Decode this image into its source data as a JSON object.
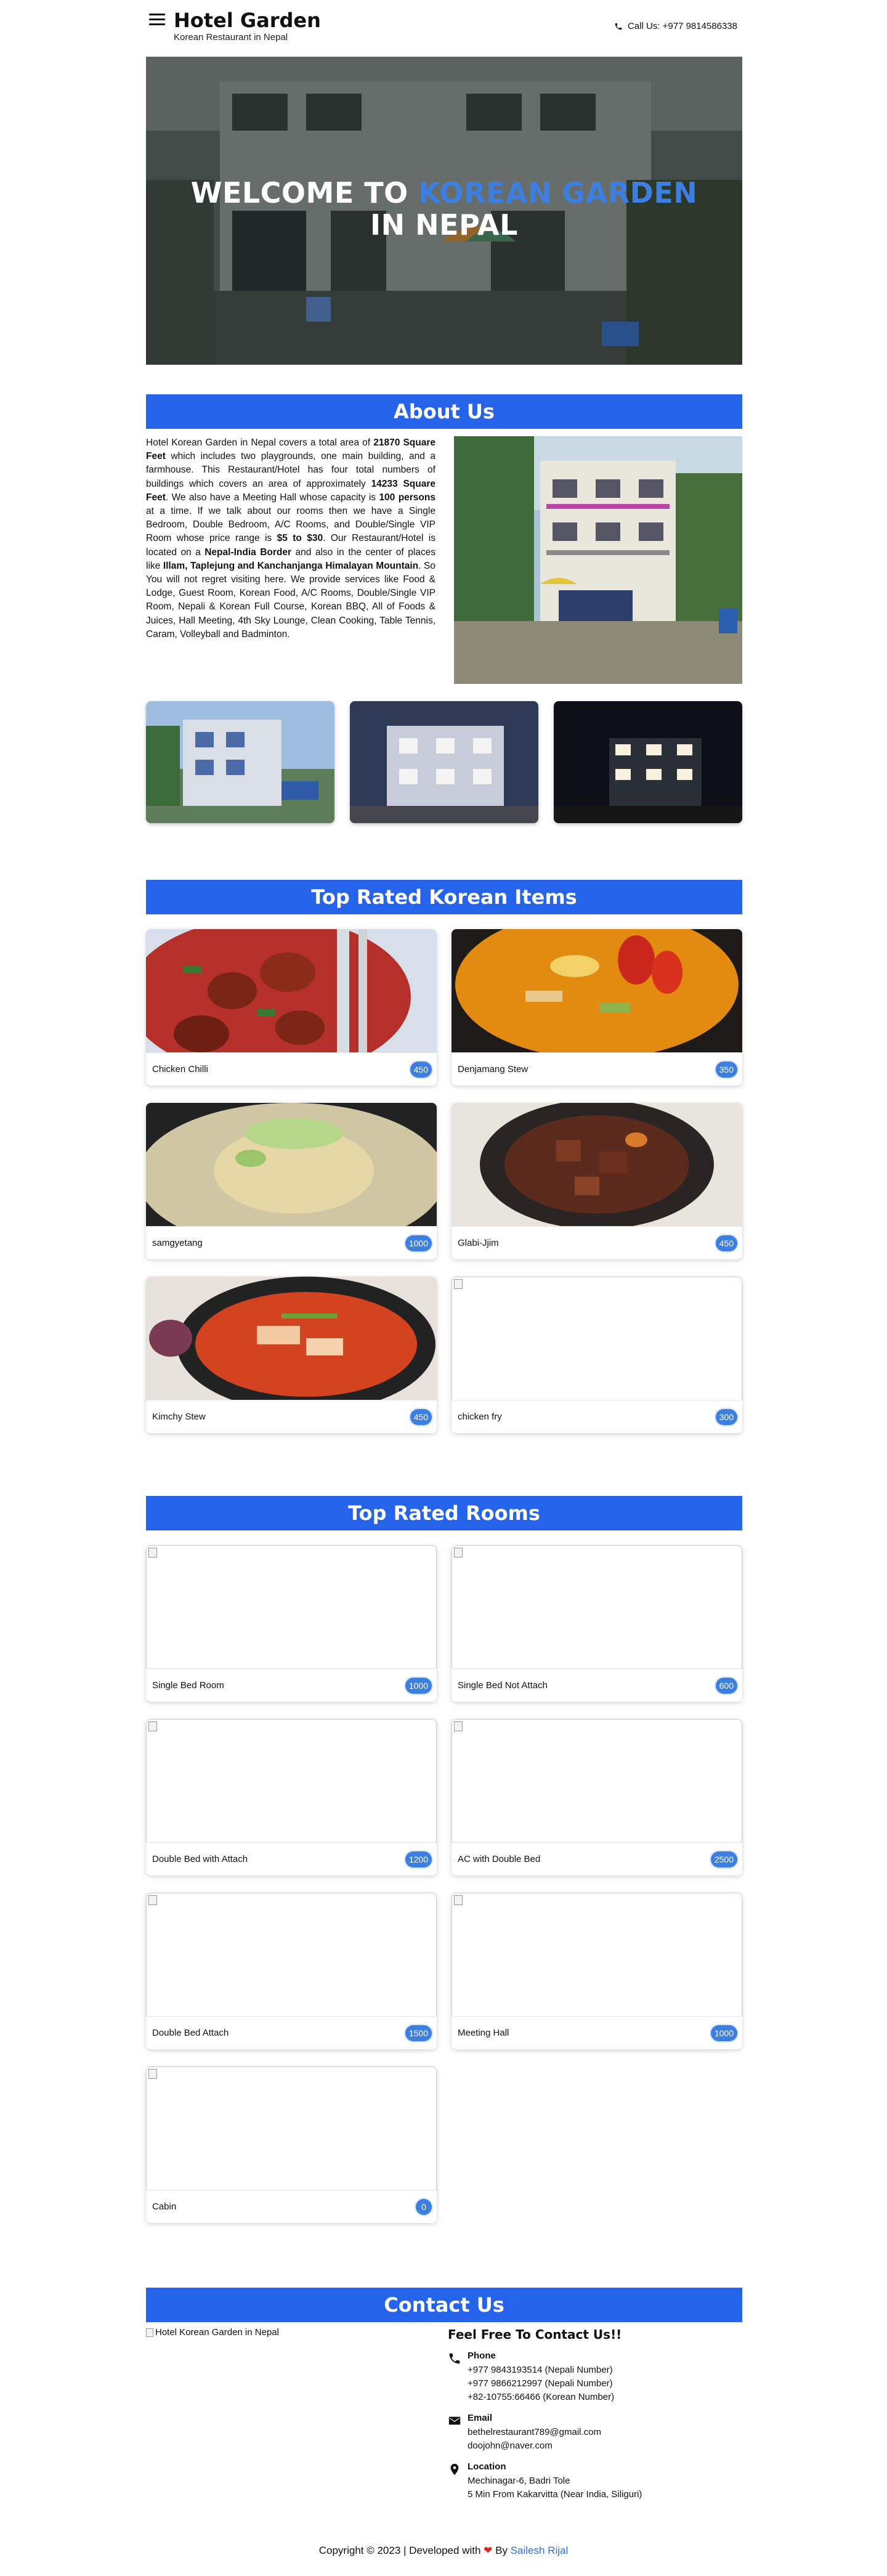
{
  "header": {
    "title": "Hotel Garden",
    "subtitle": "Korean Restaurant in Nepal",
    "call_label": "Call Us: +977 9814586338"
  },
  "hero": {
    "line1_plain": "WELCOME TO ",
    "line1_accent": "KOREAN GARDEN",
    "line2": "IN NEPAL"
  },
  "about": {
    "heading": "About Us"
  },
  "korean_items": {
    "heading": "Top Rated Korean Items",
    "items": [
      {
        "name": "Chicken Chilli",
        "price": "450"
      },
      {
        "name": "Denjamang Stew",
        "price": "350"
      },
      {
        "name": "samgyetang",
        "price": "1000"
      },
      {
        "name": "Glabi-Jjim",
        "price": "450"
      },
      {
        "name": "Kimchy Stew",
        "price": "450"
      },
      {
        "name": "chicken fry",
        "price": "300"
      }
    ]
  },
  "rooms": {
    "heading": "Top Rated Rooms",
    "items": [
      {
        "name": "Single Bed Room",
        "price": "1000"
      },
      {
        "name": "Single Bed Not Attach",
        "price": "600"
      },
      {
        "name": "Double Bed with Attach",
        "price": "1200"
      },
      {
        "name": "AC with Double Bed",
        "price": "2500"
      },
      {
        "name": "Double Bed Attach",
        "price": "1500"
      },
      {
        "name": "Meeting Hall",
        "price": "1000"
      },
      {
        "name": "Cabin",
        "price": "0"
      }
    ]
  },
  "contact": {
    "heading": "Contact Us",
    "image_alt": "Hotel Korean Garden in Nepal",
    "title": "Feel Free To Contact Us!!",
    "phone": {
      "label": "Phone",
      "lines": [
        "+977 9843193514 (Nepali Number)",
        "+977 9866212997 (Nepali Number)",
        "+82-10755:66466 (Korean Number)"
      ]
    },
    "email": {
      "label": "Email",
      "lines": [
        "bethelrestaurant789@gmail.com",
        "doojohn@naver.com"
      ]
    },
    "location": {
      "label": "Location",
      "lines": [
        "Mechinagar-6, Badri Tole",
        "5 Min From Kakarvitta (Near India, Siliguri)"
      ]
    }
  },
  "footer": {
    "text": "Copyright © 2023 | Developed with",
    "by": "By",
    "author": "Sailesh Rijal"
  },
  "colors": {
    "accent": "#2563eb",
    "badge": "#3c7fe0"
  }
}
